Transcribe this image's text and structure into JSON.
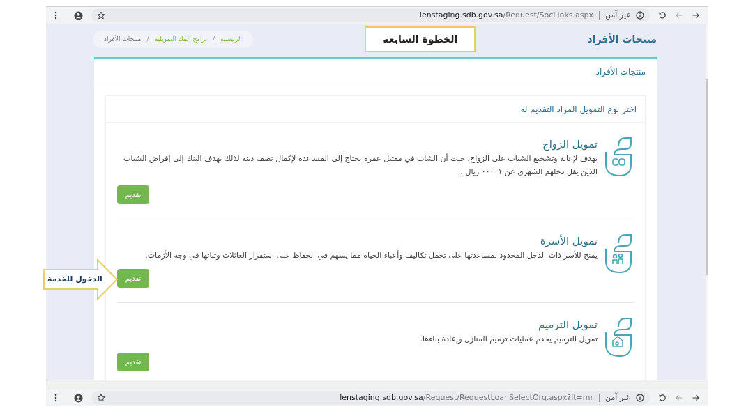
{
  "browser_bars": [
    {
      "security": "غير آمن",
      "url_host": "lenstaging.sdb.gov.sa",
      "url_path": "/Request/SocLinks.aspx"
    },
    {
      "security": "غير آمن",
      "url_host": "lenstaging.sdb.gov.sa",
      "url_path": "/Request/RequestLoanSelectOrg.aspx?lt=mr"
    }
  ],
  "page_title": "منتجات الأفراد",
  "step_label": "الخطوة السابعة",
  "breadcrumb": {
    "separator": "/",
    "items": [
      {
        "label": "الرئيسية",
        "kind": "link"
      },
      {
        "label": "برامج البنك التمويلية",
        "kind": "link"
      },
      {
        "label": "منتجات الأفراد",
        "kind": "current"
      }
    ]
  },
  "card_title": "منتجات الأفراد",
  "section_title": "اختر نوع التمويل المراد التقديم له",
  "products": [
    {
      "title": "تمويل الزواج",
      "description": "يهدف لإعانة وتشجيع الشباب على الزواج، حيث أن الشاب في مقتبل عمره يحتاج إلى المساعدة لإكمال نصف دينه لذلك يهدف البنك إلى إقراض الشباب الذين يقل دخلهم الشهري عن ٠٠٠٠١ ريال .",
      "button": "تقديم"
    },
    {
      "title": "تمويل الأسرة",
      "description": "يمنح للأسر ذات الدخل المحدود لمساعدتها على تحمل تكاليف وأعباء الحياة مما يسهم في الحفاظ على استقرار العائلات وثباتها في وجه الأزمات.",
      "button": "تقديم"
    },
    {
      "title": "تمويل الترميم",
      "description": "تمويل الترميم يخدم عمليات ترميم المنازل وإعادة بناءها.",
      "button": "تقديم"
    }
  ],
  "callout": "الدخول للخدمة"
}
